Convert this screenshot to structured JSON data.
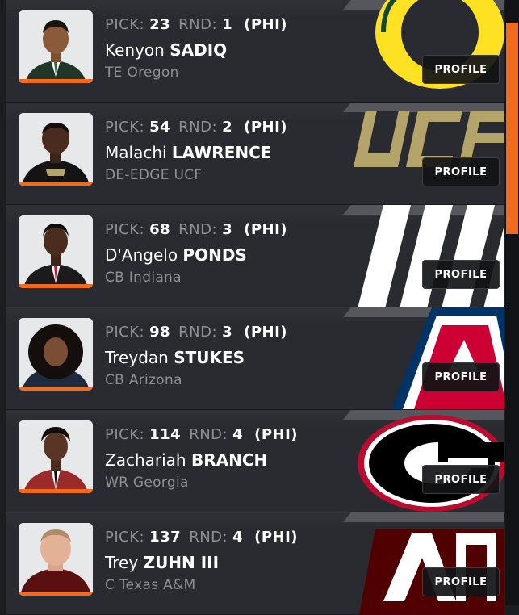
{
  "labels": {
    "pick": "PICK:",
    "round": "RND:",
    "profile": "PROFILE"
  },
  "picks": [
    {
      "pick": "23",
      "round": "1",
      "team": "(PHI)",
      "first": "Kenyon",
      "last": "SADIQ",
      "position_school": "TE Oregon",
      "school_colors": [
        "#fee123",
        "#154733"
      ]
    },
    {
      "pick": "54",
      "round": "2",
      "team": "(PHI)",
      "first": "Malachi",
      "last": "LAWRENCE",
      "position_school": "DE-EDGE UCF",
      "school_colors": [
        "#b5a46a",
        "#000000"
      ]
    },
    {
      "pick": "68",
      "round": "3",
      "team": "(PHI)",
      "first": "D'Angelo",
      "last": "PONDS",
      "position_school": "CB Indiana",
      "school_colors": [
        "#ffffff",
        "#990000"
      ]
    },
    {
      "pick": "98",
      "round": "3",
      "team": "(PHI)",
      "first": "Treydan",
      "last": "STUKES",
      "position_school": "CB Arizona",
      "school_colors": [
        "#cc0033",
        "#003366"
      ]
    },
    {
      "pick": "114",
      "round": "4",
      "team": "(PHI)",
      "first": "Zachariah",
      "last": "BRANCH",
      "position_school": "WR Georgia",
      "school_colors": [
        "#ba0c2f",
        "#000000"
      ]
    },
    {
      "pick": "137",
      "round": "4",
      "team": "(PHI)",
      "first": "Trey",
      "last": "ZUHN III",
      "position_school": "C Texas A&M",
      "school_colors": [
        "#500000",
        "#ffffff"
      ]
    }
  ],
  "accent_color": "#f26b1d"
}
